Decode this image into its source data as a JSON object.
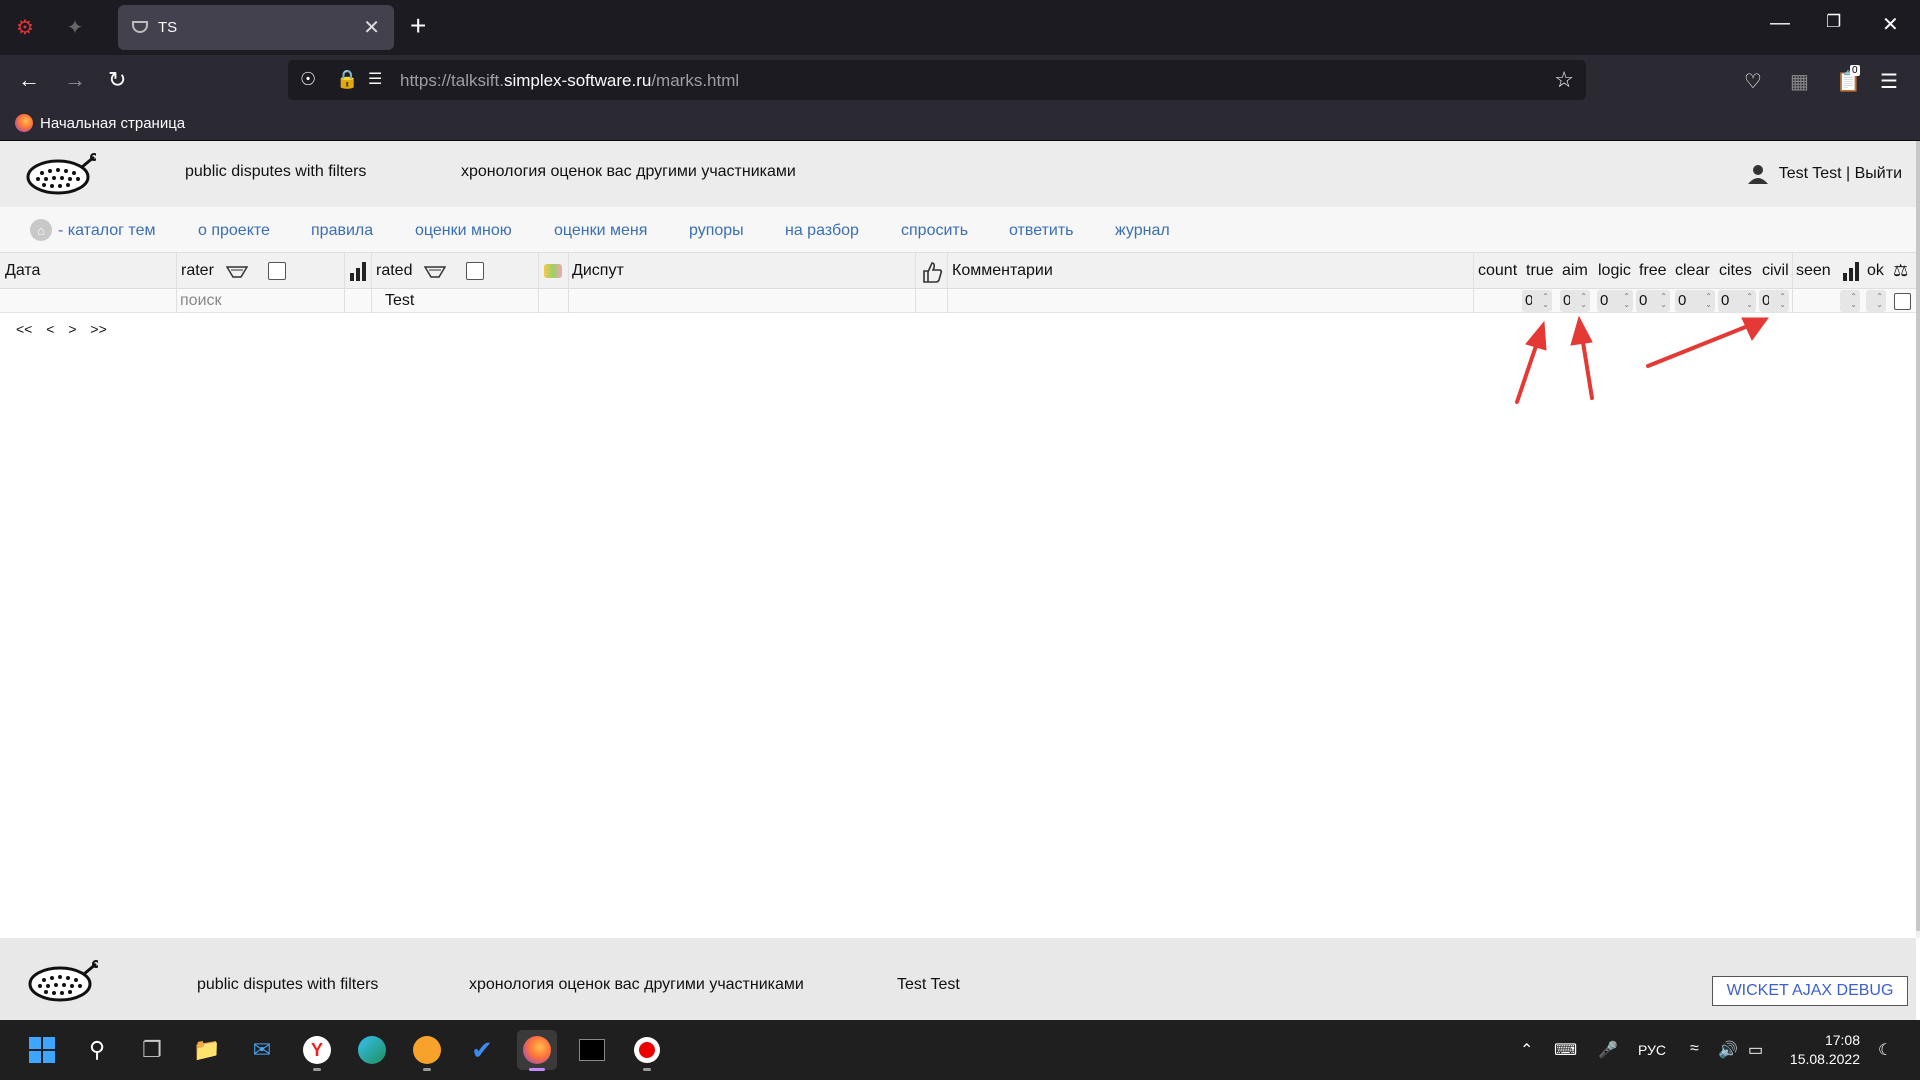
{
  "browser": {
    "tab_title": "TS",
    "url_prefix": "https://talksift.",
    "url_host": "simplex-software.ru",
    "url_path": "/marks.html",
    "bookmark_label": "Начальная страница",
    "extension_badge": "0"
  },
  "header": {
    "link_disputes": "public disputes with filters",
    "link_chronology": "хронология оценок вас другими участниками",
    "user_label": "Test Test | Выйти"
  },
  "menu": {
    "items": [
      {
        "label": "- каталог тем"
      },
      {
        "label": "о проекте"
      },
      {
        "label": "правила"
      },
      {
        "label": "оценки мною"
      },
      {
        "label": "оценки меня"
      },
      {
        "label": "рупоры"
      },
      {
        "label": "на разбор"
      },
      {
        "label": "спросить"
      },
      {
        "label": "ответить"
      },
      {
        "label": "журнал"
      }
    ]
  },
  "table": {
    "headers": {
      "date": "Дата",
      "rater": "rater",
      "rated": "rated",
      "dispute": "Диспут",
      "comments": "Комментарии",
      "count": "count",
      "true": "true",
      "aim": "aim",
      "logic": "logic",
      "free": "free",
      "clear": "clear",
      "cites": "cites",
      "civil": "civil",
      "seen": "seen",
      "ok": "ok"
    },
    "filters": {
      "rater_placeholder": "поиск",
      "rated_value": "Test",
      "true": "0",
      "aim": "0",
      "logic": "0",
      "free": "0",
      "clear": "0",
      "cites": "0",
      "civil": "0"
    },
    "pager": {
      "first": "<<",
      "prev": "<",
      "next": ">",
      "last": ">>"
    }
  },
  "footer": {
    "link_disputes": "public disputes with filters",
    "link_chronology": "хронология оценок вас другими участниками",
    "user_name": "Test Test",
    "debug_button": "WICKET AJAX DEBUG"
  },
  "taskbar": {
    "language": "РУС",
    "time": "17:08",
    "date": "15.08.2022"
  },
  "colors": {
    "link_blue": "#3a6fb5",
    "annotation_red": "#e53935",
    "browser_dark": "#1c1b22"
  }
}
